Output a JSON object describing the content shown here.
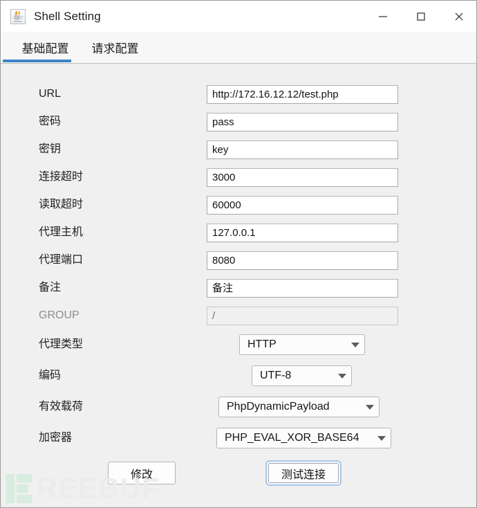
{
  "window": {
    "title": "Shell Setting",
    "icon": "java-cup-icon",
    "controls": {
      "minimize": "─",
      "maximize": "□",
      "close": "✕"
    }
  },
  "tabs": [
    {
      "label": "基础配置",
      "active": true
    },
    {
      "label": "请求配置",
      "active": false
    }
  ],
  "form": {
    "fields": [
      {
        "label": "URL",
        "value": "http://172.16.12.12/test.php",
        "type": "text",
        "disabled": false
      },
      {
        "label": "密码",
        "value": "pass",
        "type": "text",
        "disabled": false
      },
      {
        "label": "密钥",
        "value": "key",
        "type": "text",
        "disabled": false
      },
      {
        "label": "连接超时",
        "value": "3000",
        "type": "text",
        "disabled": false
      },
      {
        "label": "读取超时",
        "value": "60000",
        "type": "text",
        "disabled": false
      },
      {
        "label": "代理主机",
        "value": "127.0.0.1",
        "type": "text",
        "disabled": false
      },
      {
        "label": "代理端口",
        "value": "8080",
        "type": "text",
        "disabled": false
      },
      {
        "label": "备注",
        "value": "备注",
        "type": "text",
        "disabled": false
      },
      {
        "label": "GROUP",
        "value": "/",
        "type": "text",
        "disabled": true
      },
      {
        "label": "代理类型",
        "value": "HTTP",
        "type": "select",
        "disabled": false
      },
      {
        "label": "编码",
        "value": "UTF-8",
        "type": "select",
        "disabled": false
      },
      {
        "label": "有效载荷",
        "value": "PhpDynamicPayload",
        "type": "select",
        "disabled": false
      },
      {
        "label": "加密器",
        "value": "PHP_EVAL_XOR_BASE64",
        "type": "select",
        "disabled": false
      }
    ]
  },
  "buttons": {
    "modify": "修改",
    "test_connection": "测试连接"
  },
  "watermark": {
    "text": "REEBUF"
  },
  "colors": {
    "accent": "#3d85c8",
    "focus_ring": "#a8c8e8",
    "window_bg": "#f0f0f0",
    "titlebar_bg": "#ffffff"
  }
}
